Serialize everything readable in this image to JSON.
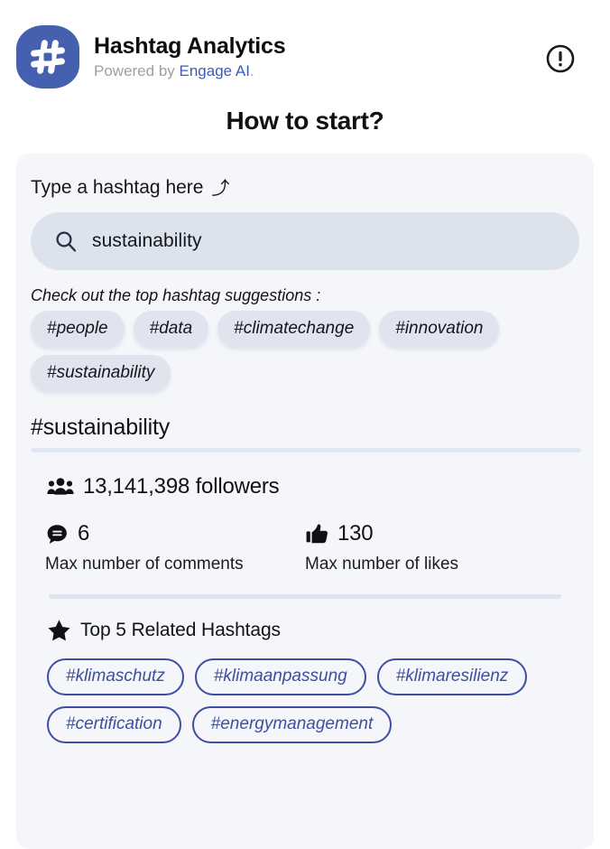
{
  "header": {
    "logo_icon": "hashtag-logo-icon",
    "title": "Hashtag Analytics",
    "powered_prefix": "Powered by ",
    "powered_link": "Engage AI",
    "powered_suffix": ".",
    "alert_icon": "exclamation-circle-icon",
    "brand_color": "#4560ae",
    "link_color": "#3b5bbd"
  },
  "page": {
    "title": "How to start?",
    "panel_bg": "#f4f6fa"
  },
  "search": {
    "label": "Type a hashtag here",
    "label_arrow": "⤴",
    "icon": "search-icon",
    "value": "sustainability",
    "placeholder": "Type a hashtag here"
  },
  "suggestions": {
    "label": "Check out the top hashtag suggestions :",
    "chips": [
      "#people",
      "#data",
      "#climatechange",
      "#innovation",
      "#sustainability"
    ]
  },
  "result": {
    "hashtag": "#sustainability",
    "followers_icon": "people-group-icon",
    "followers_count": "13,141,398",
    "followers_label": "followers",
    "followers_text": "13,141,398 followers",
    "stats": [
      {
        "icon": "comment-bubble-icon",
        "value": "6",
        "caption": "Max number of comments"
      },
      {
        "icon": "thumbs-up-icon",
        "value": "130",
        "caption": "Max number of likes"
      }
    ],
    "related": {
      "icon": "star-icon",
      "title": "Top 5 Related Hashtags",
      "chips": [
        "#klimaschutz",
        "#klimaanpassung",
        "#klimaresilienz",
        "#certification",
        "#energymanagement"
      ],
      "accent_color": "#3d4fa0"
    }
  }
}
